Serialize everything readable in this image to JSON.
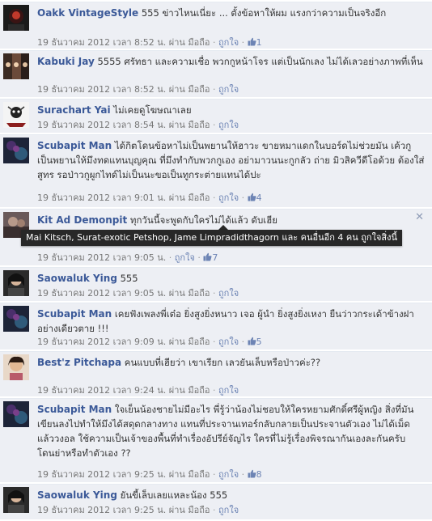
{
  "comments": [
    {
      "author": "Oakk VintageStyle",
      "text": "555 ข่าวไหนเนี่ยะ ... ตั้งข้อหาให้ผม แรงกว่าความเป็นจริงอีก",
      "date": "19 ธันวาคม 2012 เวลา 8:52 น.",
      "via": "ผ่าน มือถือ",
      "like_label": "ถูกใจ",
      "likes": "1"
    },
    {
      "author": "Kabuki Jay",
      "text": "5555 ศรัทธา และความเชื่อ พวกกูหน้าโจร แต่เป็นนักเลง ไม่ได้เลวอย่างภาพที่เห็น",
      "date": "19 ธันวาคม 2012 เวลา 8:52 น.",
      "via": "ผ่าน มือถือ",
      "like_label": "ถูกใจ",
      "likes": ""
    },
    {
      "author": "Surachart Yai",
      "text": "ไม่เคยดูโฆษณาเลย",
      "date": "19 ธันวาคม 2012 เวลา 8:54 น.",
      "via": "ผ่าน มือถือ",
      "like_label": "ถูกใจ",
      "likes": ""
    },
    {
      "author": "Scubapit Man",
      "text": "ได้กิตโดนข้อหาไม่เป็นพยานให้ฮาวะ ขายหมาแดกในบอร์ดไม่ช่วยมัน เค้วกูเป็นพยานให้มึงทดแทนบุญคุณ ที่มึงทำกับพวกกูเอง อย่ามาวนนะกูกลัว ถ่าย มิวสิควีดีโอด้วย ต้องใส่สูทร รอป่าวกูผูกไทด์ไม่เป็นนะขอเป็นทูกระต่ายแทนได้ปะ",
      "date": "19 ธันวาคม 2012 เวลา 9:01 น.",
      "via": "ผ่าน มือถือ",
      "like_label": "ถูกใจ",
      "likes": "4"
    },
    {
      "author": "Kit Ad Demonpit",
      "text": "ทุกวันนี้จะพูดกับใครไม่ได้แล้ว ดับเฮีย",
      "date": "19 ธันวาคม 2012 เวลา 9:05 น.",
      "via": "",
      "like_label": "ถูกใจ",
      "likes": "7"
    },
    {
      "author": "Saowaluk Ying",
      "text": "555",
      "date": "19 ธันวาคม 2012 เวลา 9:05 น.",
      "via": "ผ่าน มือถือ",
      "like_label": "ถูกใจ",
      "likes": ""
    },
    {
      "author": "Scubapit Man",
      "text": "เคยฟังเพลงพี่เต๋อ ยิ่งสูงยิ่งหนาว เจอ ผู้นำ ยิ่งสูงยิ่งเหงา ยืนว่าวกระเด้าข้างฝาอย่างเดียวตาย !!!",
      "date": "19 ธันวาคม 2012 เวลา 9:09 น.",
      "via": "ผ่าน มือถือ",
      "like_label": "ถูกใจ",
      "likes": "5"
    },
    {
      "author": "Best'z Pitchapa",
      "text": "คนแบบที่เฮียว่า เขาเรียก เลวยันเล็บหรือป่าวค่ะ??",
      "date": "19 ธันวาคม 2012 เวลา 9:24 น.",
      "via": "ผ่าน มือถือ",
      "like_label": "ถูกใจ",
      "likes": ""
    },
    {
      "author": "Scubapit Man",
      "text": "ใจเย็นน้องชายไม่มีอะไร พี่รู้ว่าน้องไม่ชอบให้ใครหยามศักดิ์ศรีผู้หญิง สิ่งที่มันเขียนลงไปทำให้มึงได้สดุดกลางทาง แทนที่ประจานเทอร์กลับกลายเป็นประจานตัวเอง ไม่ได้เม็ดแล้ววงอล ใช้ความเป็นเจ้าของพื้นที่ทำเรื่องอัปรีย์จัญไร ใครที่ไม่รู้เรื่องพิจรณากันเองละกันครับ โดนย่าหรือทำตัวเอง ??",
      "date": "19 ธันวาคม 2012 เวลา 9:25 น.",
      "via": "ผ่าน มือถือ",
      "like_label": "ถูกใจ",
      "likes": "8"
    },
    {
      "author": "Saowaluk Ying",
      "text": "ยันขี้เล็บเลยแหละน้อง 555",
      "date": "19 ธันวาคม 2012 เวลา 9:25 น.",
      "via": "ผ่าน มือถือ",
      "like_label": "ถูกใจ",
      "likes": ""
    }
  ],
  "tooltip": "Mai Kitsch, Surat-exotic Petshop, Jame Limpradidthagorn และ คนอื่นอีก 4 คน ถูกใจสิ่งนี้",
  "close_glyph": "✕",
  "separator": "·",
  "colors": {
    "row_bg": "#edeff4",
    "author": "#3b5998",
    "link": "#6d84b4",
    "meta": "#777777",
    "tooltip_bg": "#282828"
  },
  "icons": {
    "thumbs_up": "thumbs-up-icon",
    "close": "close-icon"
  }
}
